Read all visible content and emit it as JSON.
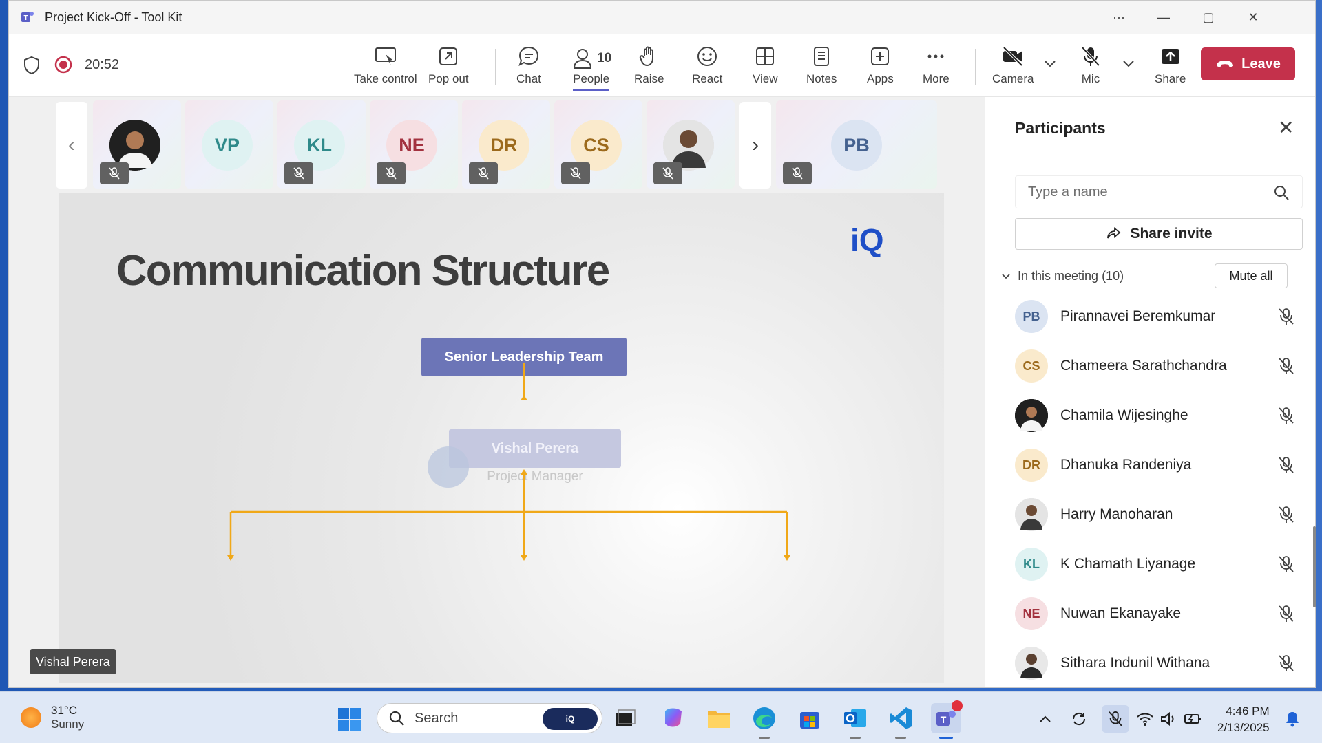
{
  "window": {
    "title": "Project Kick-Off - Tool Kit",
    "controls": {
      "more": "···",
      "minimize": "—",
      "maximize": "▢",
      "close": "✕"
    }
  },
  "meeting": {
    "timer": "20:52"
  },
  "toolbar": {
    "take_control": "Take control",
    "pop_out": "Pop out",
    "chat": "Chat",
    "people": "People",
    "people_count": "10",
    "raise": "Raise",
    "react": "React",
    "view": "View",
    "notes": "Notes",
    "apps": "Apps",
    "more": "More",
    "camera": "Camera",
    "mic": "Mic",
    "share": "Share",
    "leave": "Leave"
  },
  "strip": {
    "tiles": [
      {
        "initials": "",
        "type": "photo"
      },
      {
        "initials": "VP",
        "color": "#2f8a8a",
        "bg": "#dff2f2"
      },
      {
        "initials": "KL",
        "color": "#2f8a8a",
        "bg": "#dff2f2"
      },
      {
        "initials": "NE",
        "color": "#a3323f",
        "bg": "#f6dfe2"
      },
      {
        "initials": "DR",
        "color": "#9c6a1c",
        "bg": "#faeacc"
      },
      {
        "initials": "CS",
        "color": "#9c6a1c",
        "bg": "#faeacc"
      },
      {
        "initials": "",
        "type": "photo"
      }
    ],
    "featured": {
      "initials": "PB",
      "color": "#44618f",
      "bg": "#dbe4f2"
    }
  },
  "slide": {
    "title": "Communication Structure",
    "logo": "iQ",
    "senior_box": "Senior Leadership Team",
    "pm_name": "Vishal Perera",
    "pm_role": "Project Manager"
  },
  "speaker_name": "Vishal Perera",
  "panel": {
    "title": "Participants",
    "search_placeholder": "Type a name",
    "share_invite": "Share invite",
    "section_label": "In this meeting (10)",
    "mute_all": "Mute all",
    "participants": [
      {
        "initials": "PB",
        "name": "Pirannavei Beremkumar",
        "color": "#44618f",
        "bg": "#dbe4f2"
      },
      {
        "initials": "CS",
        "name": "Chameera Sarathchandra",
        "color": "#9c6a1c",
        "bg": "#faeacc"
      },
      {
        "initials": "",
        "name": "Chamila Wijesinghe",
        "photo": true
      },
      {
        "initials": "DR",
        "name": "Dhanuka Randeniya",
        "color": "#9c6a1c",
        "bg": "#faeacc"
      },
      {
        "initials": "",
        "name": "Harry Manoharan",
        "photo": true
      },
      {
        "initials": "KL",
        "name": "K Chamath Liyanage",
        "color": "#2f8a8a",
        "bg": "#dff2f2"
      },
      {
        "initials": "NE",
        "name": "Nuwan Ekanayake",
        "color": "#a3323f",
        "bg": "#f6dfe2"
      },
      {
        "initials": "",
        "name": "Sithara Indunil Withana",
        "photo": true
      }
    ]
  },
  "taskbar": {
    "temperature": "31°C",
    "weather": "Sunny",
    "search_label": "Search",
    "search_badge": "iQ",
    "time": "4:46 PM",
    "date": "2/13/2025"
  },
  "colors": {
    "accent": "#5b5fc7",
    "leave": "#c4314b",
    "slide_box": "#6c75b7",
    "connector": "#f0a818"
  }
}
